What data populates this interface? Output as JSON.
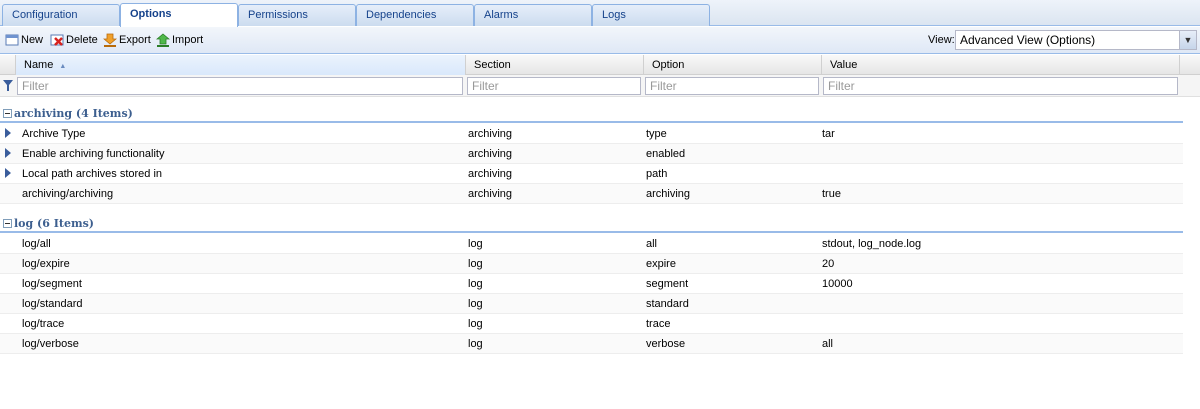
{
  "tabs": [
    {
      "label": "Configuration",
      "active": false
    },
    {
      "label": "Options",
      "active": true
    },
    {
      "label": "Permissions",
      "active": false
    },
    {
      "label": "Dependencies",
      "active": false
    },
    {
      "label": "Alarms",
      "active": false
    },
    {
      "label": "Logs",
      "active": false
    }
  ],
  "toolbar": {
    "new_label": "New",
    "delete_label": "Delete",
    "export_label": "Export",
    "import_label": "Import",
    "view_label": "View:",
    "view_value": "Advanced View (Options)"
  },
  "grid": {
    "columns": [
      "Name",
      "Section",
      "Option",
      "Value"
    ],
    "sort_indicator": "▲",
    "filter_placeholder": "Filter",
    "groups": [
      {
        "title": "archiving (4 Items)",
        "rows": [
          {
            "name": "Archive Type",
            "section": "archiving",
            "option": "type",
            "value": "tar",
            "expandable": true
          },
          {
            "name": "Enable archiving functionality",
            "section": "archiving",
            "option": "enabled",
            "value": "",
            "expandable": true
          },
          {
            "name": "Local path archives stored in",
            "section": "archiving",
            "option": "path",
            "value": "",
            "expandable": true
          },
          {
            "name": "archiving/archiving",
            "section": "archiving",
            "option": "archiving",
            "value": "true",
            "expandable": false
          }
        ]
      },
      {
        "title": "log (6 Items)",
        "rows": [
          {
            "name": "log/all",
            "section": "log",
            "option": "all",
            "value": "stdout, log_node.log",
            "expandable": false
          },
          {
            "name": "log/expire",
            "section": "log",
            "option": "expire",
            "value": "20",
            "expandable": false
          },
          {
            "name": "log/segment",
            "section": "log",
            "option": "segment",
            "value": "10000",
            "expandable": false
          },
          {
            "name": "log/standard",
            "section": "log",
            "option": "standard",
            "value": "",
            "expandable": false
          },
          {
            "name": "log/trace",
            "section": "log",
            "option": "trace",
            "value": "",
            "expandable": false
          },
          {
            "name": "log/verbose",
            "section": "log",
            "option": "verbose",
            "value": "all",
            "expandable": false
          }
        ]
      }
    ]
  }
}
